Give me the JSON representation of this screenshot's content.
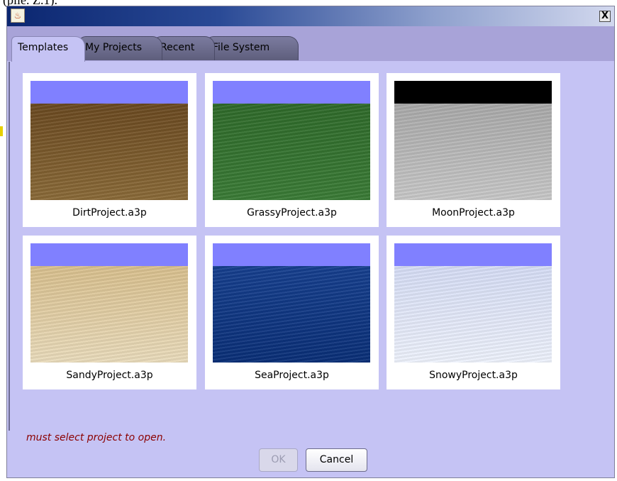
{
  "caption_fragment": "(pile. Z.1).",
  "window": {
    "title": "",
    "close_label": "X"
  },
  "tabs": [
    {
      "label": "Templates",
      "active": true
    },
    {
      "label": "My Projects",
      "active": false
    },
    {
      "label": "Recent",
      "active": false
    },
    {
      "label": "File System",
      "active": false
    }
  ],
  "templates": [
    {
      "label": "DirtProject.a3p",
      "sky_color": "#8080ff",
      "ground_top": "#6a4920",
      "ground_bottom": "#8a6a38"
    },
    {
      "label": "GrassyProject.a3p",
      "sky_color": "#8080ff",
      "ground_top": "#2f6a2a",
      "ground_bottom": "#3a7b36"
    },
    {
      "label": "MoonProject.a3p",
      "sky_color": "#000000",
      "ground_top": "#a9a9a9",
      "ground_bottom": "#c8c8c8"
    },
    {
      "label": "SandyProject.a3p",
      "sky_color": "#8080ff",
      "ground_top": "#d9c08e",
      "ground_bottom": "#eadcbc"
    },
    {
      "label": "SeaProject.a3p",
      "sky_color": "#8080ff",
      "ground_top": "#163f8e",
      "ground_bottom": "#0a2f77"
    },
    {
      "label": "SnowyProject.a3p",
      "sky_color": "#8080ff",
      "ground_top": "#d6ddf5",
      "ground_bottom": "#eef2fc"
    }
  ],
  "status_message": "must select project to open.",
  "buttons": {
    "ok_label": "OK",
    "ok_enabled": false,
    "cancel_label": "Cancel"
  }
}
